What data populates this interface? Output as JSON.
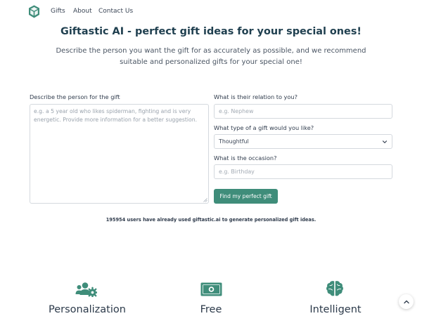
{
  "nav": {
    "logo_icon": "gift-box-logo-icon",
    "links": [
      "Gifts",
      "About",
      "Contact Us"
    ]
  },
  "hero": {
    "title": "Giftastic AI - perfect gift ideas for your special ones!",
    "subtitle": "Describe the person you want the gift for as accurately as possible, and we recommend suitable and personalized gifts for your special one!"
  },
  "form": {
    "description": {
      "label": "Describe the person for the gift",
      "placeholder": "e.g. a 5 year old who likes spiderman, fighting and is very energetic. Provide more information for a better suggestion.",
      "value": ""
    },
    "relation": {
      "label": "What is their relation to you?",
      "placeholder": "e.g. Nephew",
      "value": ""
    },
    "gift_type": {
      "label": "What type of a gift would you like?",
      "selected": "Thoughtful"
    },
    "occasion": {
      "label": "What is the occasion?",
      "placeholder": "e.g. Birthday",
      "value": ""
    },
    "submit_label": "Find my perfect gift"
  },
  "stats": {
    "users_text": "195954 users have already used giftastic.ai to generate personalized gift ideas."
  },
  "features": [
    {
      "icon": "users-cog-icon",
      "label": "Personalization"
    },
    {
      "icon": "money-bill-icon",
      "label": "Free"
    },
    {
      "icon": "brain-icon",
      "label": "Intelligent"
    }
  ],
  "scroll_top_icon": "chevron-up-icon",
  "colors": {
    "accent": "#3f8d7a",
    "heading": "#1f3f4f",
    "text": "#2f3b4c",
    "border": "#d4d9de"
  }
}
